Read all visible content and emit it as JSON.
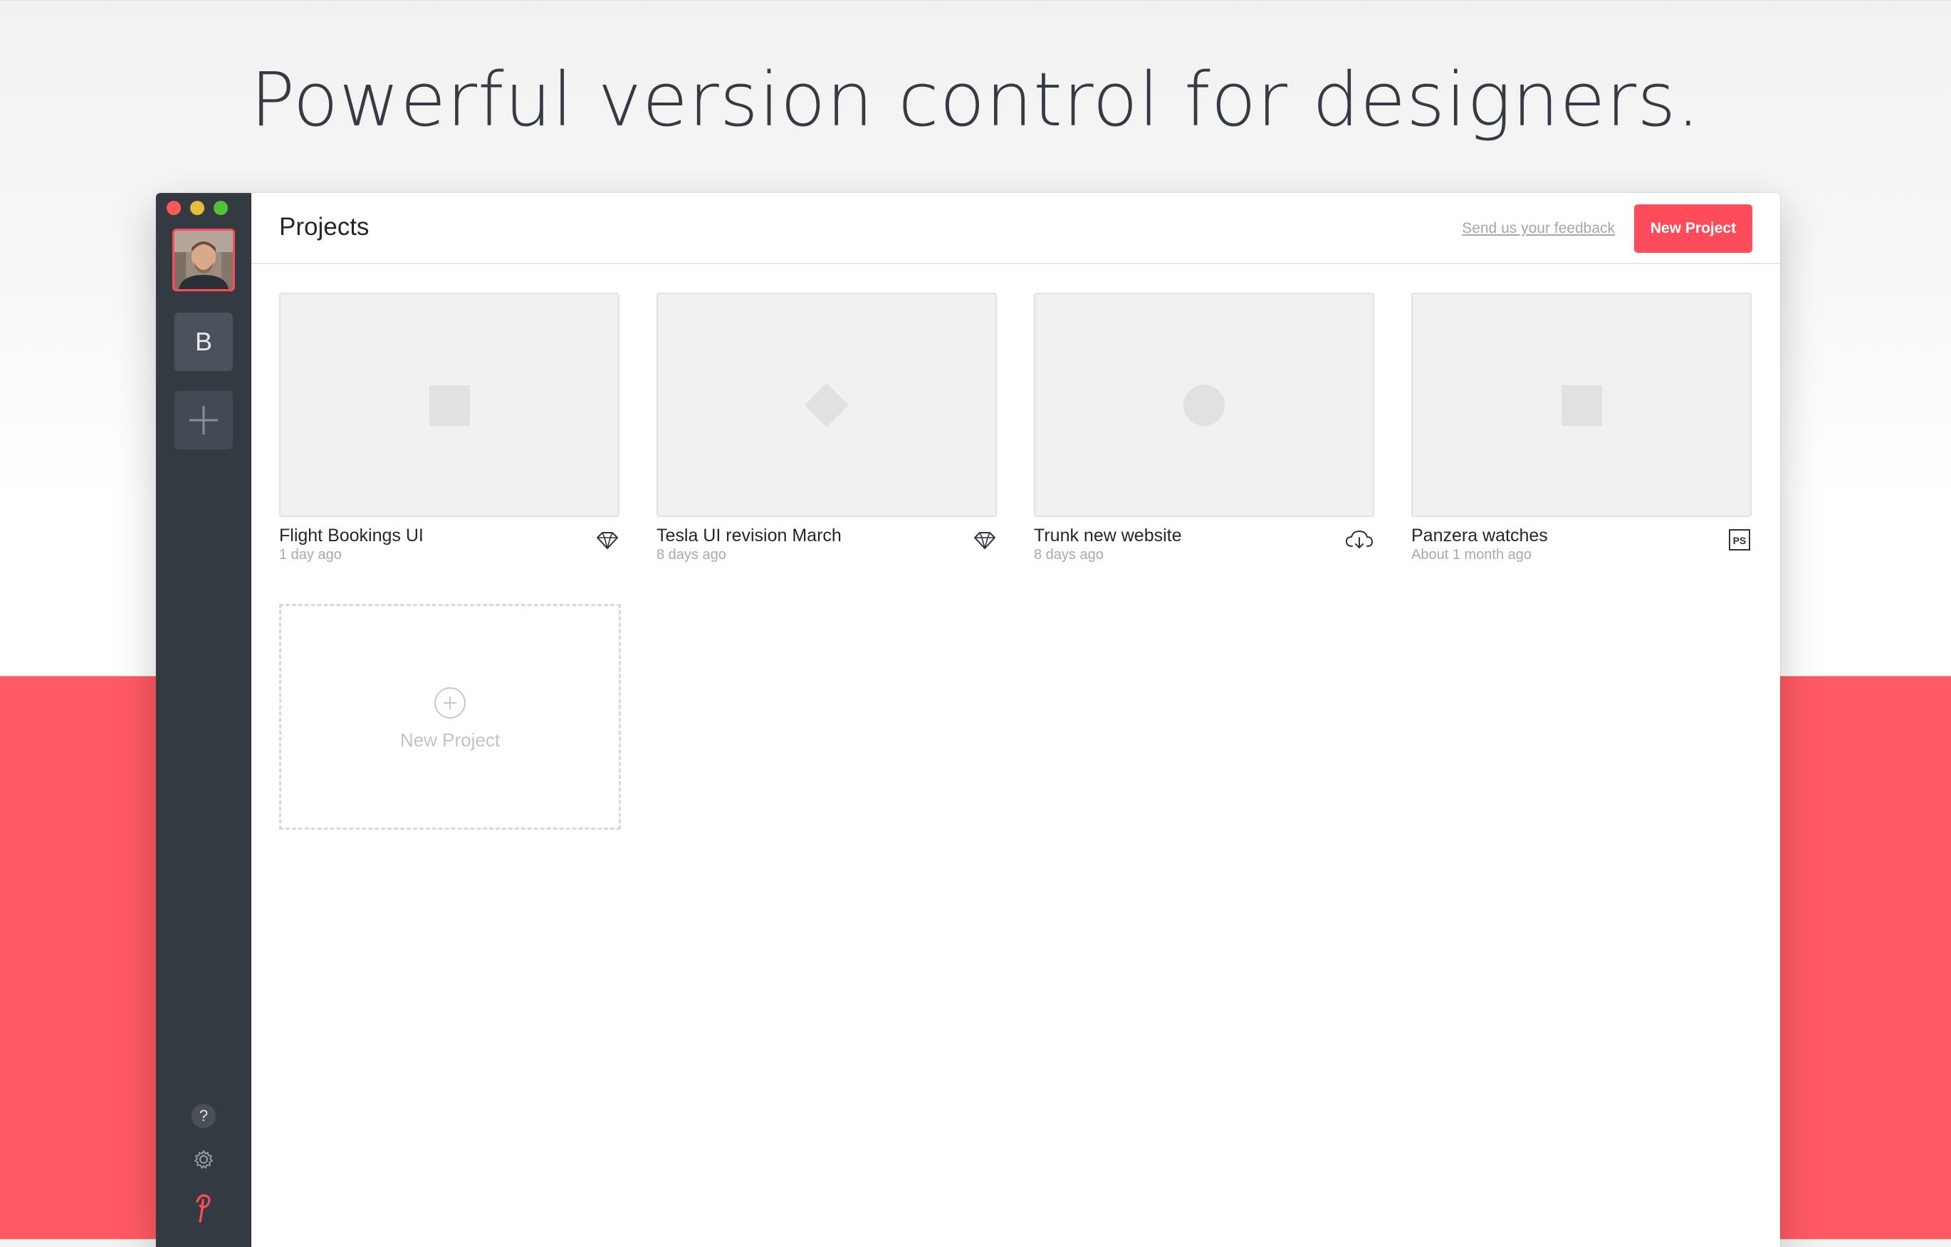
{
  "hero": {
    "headline": "Powerful version control for designers."
  },
  "window": {
    "sidebar": {
      "team_letter": "B",
      "help_label": "?",
      "icons": [
        "avatar",
        "team-b",
        "plus-icon",
        "help-icon",
        "gear-icon",
        "logo-icon"
      ]
    },
    "header": {
      "title": "Projects",
      "feedback_label": "Send us your feedback",
      "new_project_label": "New Project"
    },
    "projects": [
      {
        "name": "Flight Bookings UI",
        "time": "1 day ago",
        "thumb_shape": "square",
        "source_icon": "sketch-icon"
      },
      {
        "name": "Tesla UI revision March",
        "time": "8 days ago",
        "thumb_shape": "diamond",
        "source_icon": "sketch-icon"
      },
      {
        "name": "Trunk new website",
        "time": "8 days ago",
        "thumb_shape": "circle",
        "source_icon": "cloud-download-icon"
      },
      {
        "name": "Panzera watches",
        "time": "About 1 month ago",
        "thumb_shape": "square",
        "source_icon": "photoshop-icon",
        "source_icon_text": "PS"
      }
    ],
    "new_project_card": {
      "label": "New Project"
    }
  },
  "colors": {
    "accent": "#ff4b5a",
    "sidebar": "#343a42",
    "band": "#ff5a63"
  }
}
